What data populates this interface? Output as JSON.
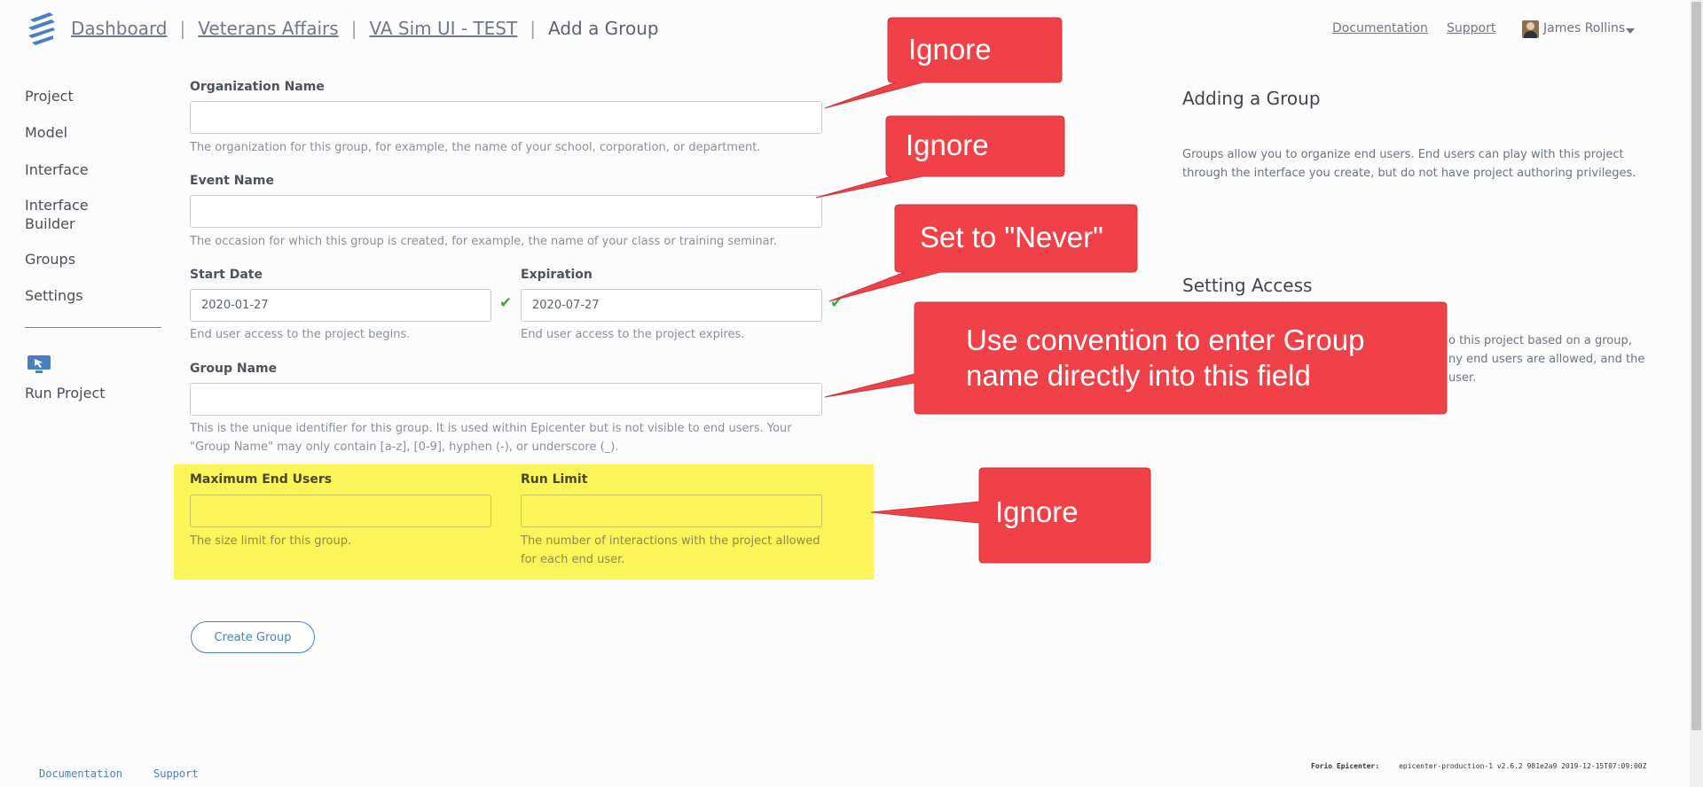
{
  "header": {
    "breadcrumb": [
      {
        "label": "Dashboard"
      },
      {
        "label": "Veterans Affairs"
      },
      {
        "label": "VA Sim UI - TEST"
      }
    ],
    "separator": "|",
    "current": "Add a Group",
    "links": {
      "documentation": "Documentation",
      "support": "Support"
    },
    "user": {
      "name": "James Rollins"
    }
  },
  "sidebar": {
    "items": [
      {
        "label": "Project"
      },
      {
        "label": "Model"
      },
      {
        "label": "Interface"
      },
      {
        "label": "Interface Builder"
      },
      {
        "label": "Groups"
      },
      {
        "label": "Settings"
      }
    ],
    "run_project": "Run Project"
  },
  "form": {
    "organization": {
      "label": "Organization Name",
      "value": "",
      "help": "The organization for this group, for example, the name of your school, corporation, or department."
    },
    "event": {
      "label": "Event Name",
      "value": "",
      "help": "The occasion for which this group is created, for example, the name of your class or training seminar."
    },
    "start_date": {
      "label": "Start Date",
      "value": "2020-01-27",
      "help": "End user access to the project begins."
    },
    "expiration": {
      "label": "Expiration",
      "value": "2020-07-27",
      "help": "End user access to the project expires."
    },
    "group_name": {
      "label": "Group Name",
      "value": "",
      "help": "This is the unique identifier for this group. It is used within Epicenter but is not visible to end users. Your \"Group Name\" may only contain [a-z], [0-9], hyphen (-), or underscore (_)."
    },
    "max_users": {
      "label": "Maximum End Users",
      "value": "",
      "help": "The size limit for this group."
    },
    "run_limit": {
      "label": "Run Limit",
      "value": "",
      "help": "The number of interactions with the project allowed for each end user."
    },
    "submit": "Create Group"
  },
  "help_panel": {
    "adding_title": "Adding a Group",
    "adding_text": "Groups allow you to organize end users. End users can play with this project through the interface you create, but do not have project authoring privileges.",
    "access_title": "Setting Access",
    "access_text_line1": "o this project based on a group,",
    "access_text_line2": "ny end users are allowed, and the",
    "access_text_line3": "user."
  },
  "callouts": {
    "c1": "Ignore",
    "c2": "Ignore",
    "c3": "Set to \"Never\"",
    "c4_line1": "Use convention to enter Group",
    "c4_line2": "name directly into this field",
    "c5": "Ignore"
  },
  "footer": {
    "documentation": "Documentation",
    "support": "Support",
    "product": "Forio Epicenter:",
    "build": "epicenter-production-1 v2.6.2 981e2a9 2019-12-15T07:09:00Z"
  },
  "colors": {
    "callout": "#f04148",
    "highlight": "#fcf559",
    "accent": "#4a7fc0",
    "check": "#3fa34d"
  }
}
